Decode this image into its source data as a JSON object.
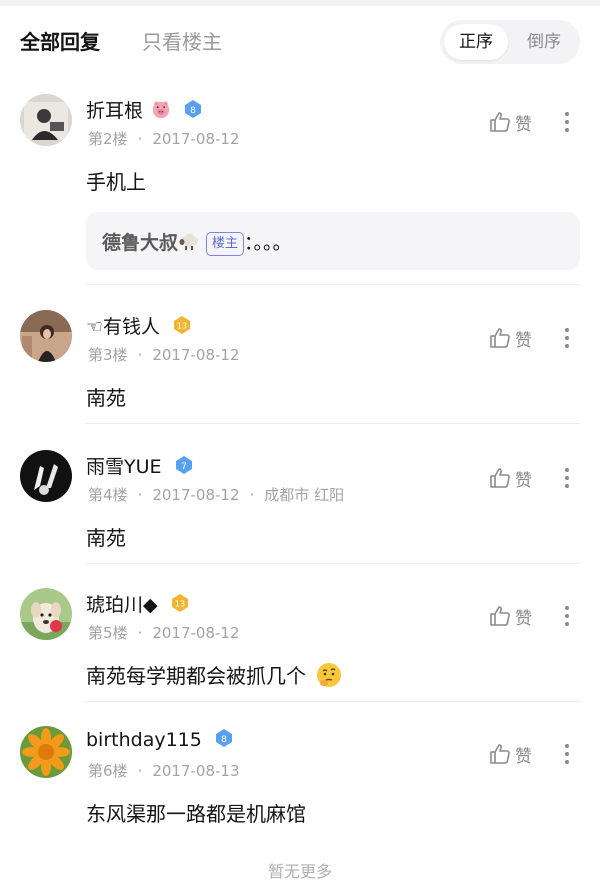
{
  "header": {
    "tab_all": "全部回复",
    "tab_owner": "只看楼主",
    "sort_asc": "正序",
    "sort_desc": "倒序"
  },
  "posts": [
    {
      "username": "折耳根",
      "level": "8",
      "level_color": "#5aa0f0",
      "floor": "第2楼",
      "date": "2017-08-12",
      "location": "",
      "content": "手机上",
      "quote": {
        "author": "德鲁大叔",
        "tag": "楼主",
        "text": "：。。。"
      },
      "like_label": "赞"
    },
    {
      "username": "☜有钱人",
      "level": "13",
      "level_color": "#f2b530",
      "floor": "第3楼",
      "date": "2017-08-12",
      "location": "",
      "content": "南苑",
      "like_label": "赞"
    },
    {
      "username": "雨雪YUE",
      "level": "7",
      "level_color": "#5aa0f0",
      "floor": "第4楼",
      "date": "2017-08-12",
      "location": "成都市 红阳",
      "content": "南苑",
      "like_label": "赞"
    },
    {
      "username": "琥珀川◆",
      "level": "13",
      "level_color": "#f2b530",
      "floor": "第5楼",
      "date": "2017-08-12",
      "location": "",
      "content": "南苑每学期都会被抓几个",
      "like_label": "赞"
    },
    {
      "username": "birthday115",
      "level": "8",
      "level_color": "#5aa0f0",
      "floor": "第6楼",
      "date": "2017-08-13",
      "location": "",
      "content": "东风渠那一路都是机麻馆",
      "like_label": "赞"
    }
  ],
  "footer": {
    "text": "暂无更多"
  }
}
